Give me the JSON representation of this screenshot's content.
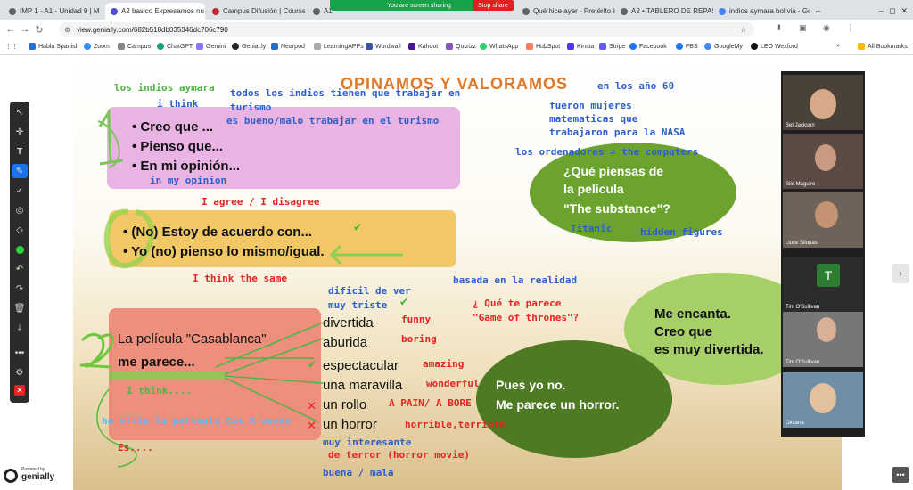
{
  "browser": {
    "tabs": [
      "IMP 1 - A1 - Unidad 9 | M",
      "A2 basico Expresamos nu",
      "Campus Difusión | Course",
      "A1",
      "Qué hice ayer - Pretérito in",
      "A2 • TABLERO DE REPASO",
      "indios aymara bolivia - Go"
    ],
    "new_tab": "+",
    "sharing_text": "You are screen sharing",
    "stop_share": "Stop share",
    "url": "view.genially.com/682b518db035346dc706c790",
    "bookmarks": [
      "Habla Spanish",
      "Zoom",
      "Campus",
      "ChatGPT",
      "Gemini",
      "Genial.ly",
      "Nearpod",
      "LearningAPPs",
      "Wordwall",
      "Kahoot",
      "Quizizz",
      "WhatsApp",
      "HubSpot",
      "Kinsta",
      "Stripe",
      "Facebook",
      "FBS",
      "GoogleMy",
      "MyBusiness",
      "LEO Wexford"
    ],
    "all_bookmarks": "All Bookmarks",
    "more": "»"
  },
  "slide": {
    "title": "OPINAMOS  Y  VALORAMOS",
    "box1": [
      "Creo que ...",
      "Pienso que...",
      "En mi opinión..."
    ],
    "box2": [
      "(No) Estoy de acuerdo con...",
      "Yo (no) pienso lo mismo/igual."
    ],
    "box3a": "La película \"Casablanca\"",
    "box3b": "me parece...",
    "adjectives": [
      "divertida",
      "aburida",
      "espectacular",
      "una maravilla",
      "un rollo",
      "un horror"
    ],
    "bubble_left": [
      "¿Qué piensas de",
      "la pelicula",
      "\"The substance\"?"
    ],
    "bubble_right": [
      "Me encanta.",
      "Creo que",
      "es muy divertida."
    ],
    "bubble_dark": [
      "Pues yo no.",
      "Me parece un horror."
    ],
    "annotations": {
      "los_indios": "los indios aymara",
      "i_think": "i think",
      "todos": "todos los indios tienen que trabajar en",
      "turismo": "turismo",
      "es_bueno": "es bueno/malo trabajar en el turismo",
      "en_los": "en los año 60",
      "fueron": "fueron mujeres",
      "matematicas": "matematicas que",
      "trabajaron": "trabajaron para la NASA",
      "ordenadores": "los ordenadores = the computers",
      "in_my": "in my opinion",
      "i_agree": "I agree / I disagree",
      "titanic": "Titanic",
      "hidden": "hidden figures",
      "i_think_same": "I think the same",
      "basada": "basada en la realidad",
      "dificil": "dificil de ver",
      "muy_triste": "muy triste",
      "que_te": "¿ Qué te parece",
      "game": "\"Game of thrones\"?",
      "funny": "funny",
      "boring": "boring",
      "amazing": "amazing",
      "wonderful": "wonderful",
      "pain": "A PAIN/ A BORE",
      "horrible": "horrible,terrible",
      "i_think2": "I think....",
      "he_visto": "he visto la pelicula Cas 8 veces",
      "muy_int": "muy interesante",
      "terror": "de terror (horror movie)",
      "es": "Es....",
      "buena": "buena / mala"
    }
  },
  "participants": [
    "Bet Jackson",
    "Sile Maguire",
    "Lluce Silunas",
    "Tim O'Sullivan",
    "Tim O'Sullivan",
    "Oksana"
  ],
  "participant_initial": "T",
  "genially": {
    "powered": "Powered by",
    "brand": "genially"
  },
  "colors": {
    "pink_box": "#e9b4e4",
    "yellow_box": "#f1c865",
    "salmon_box": "#ec8f7d",
    "bubble_green": "#6ca32f",
    "bubble_light": "#a7cf68",
    "bubble_dark": "#4d7a22",
    "title": "#e07a2a",
    "blue_note": "#2d5ec9",
    "red_note": "#e52323"
  }
}
